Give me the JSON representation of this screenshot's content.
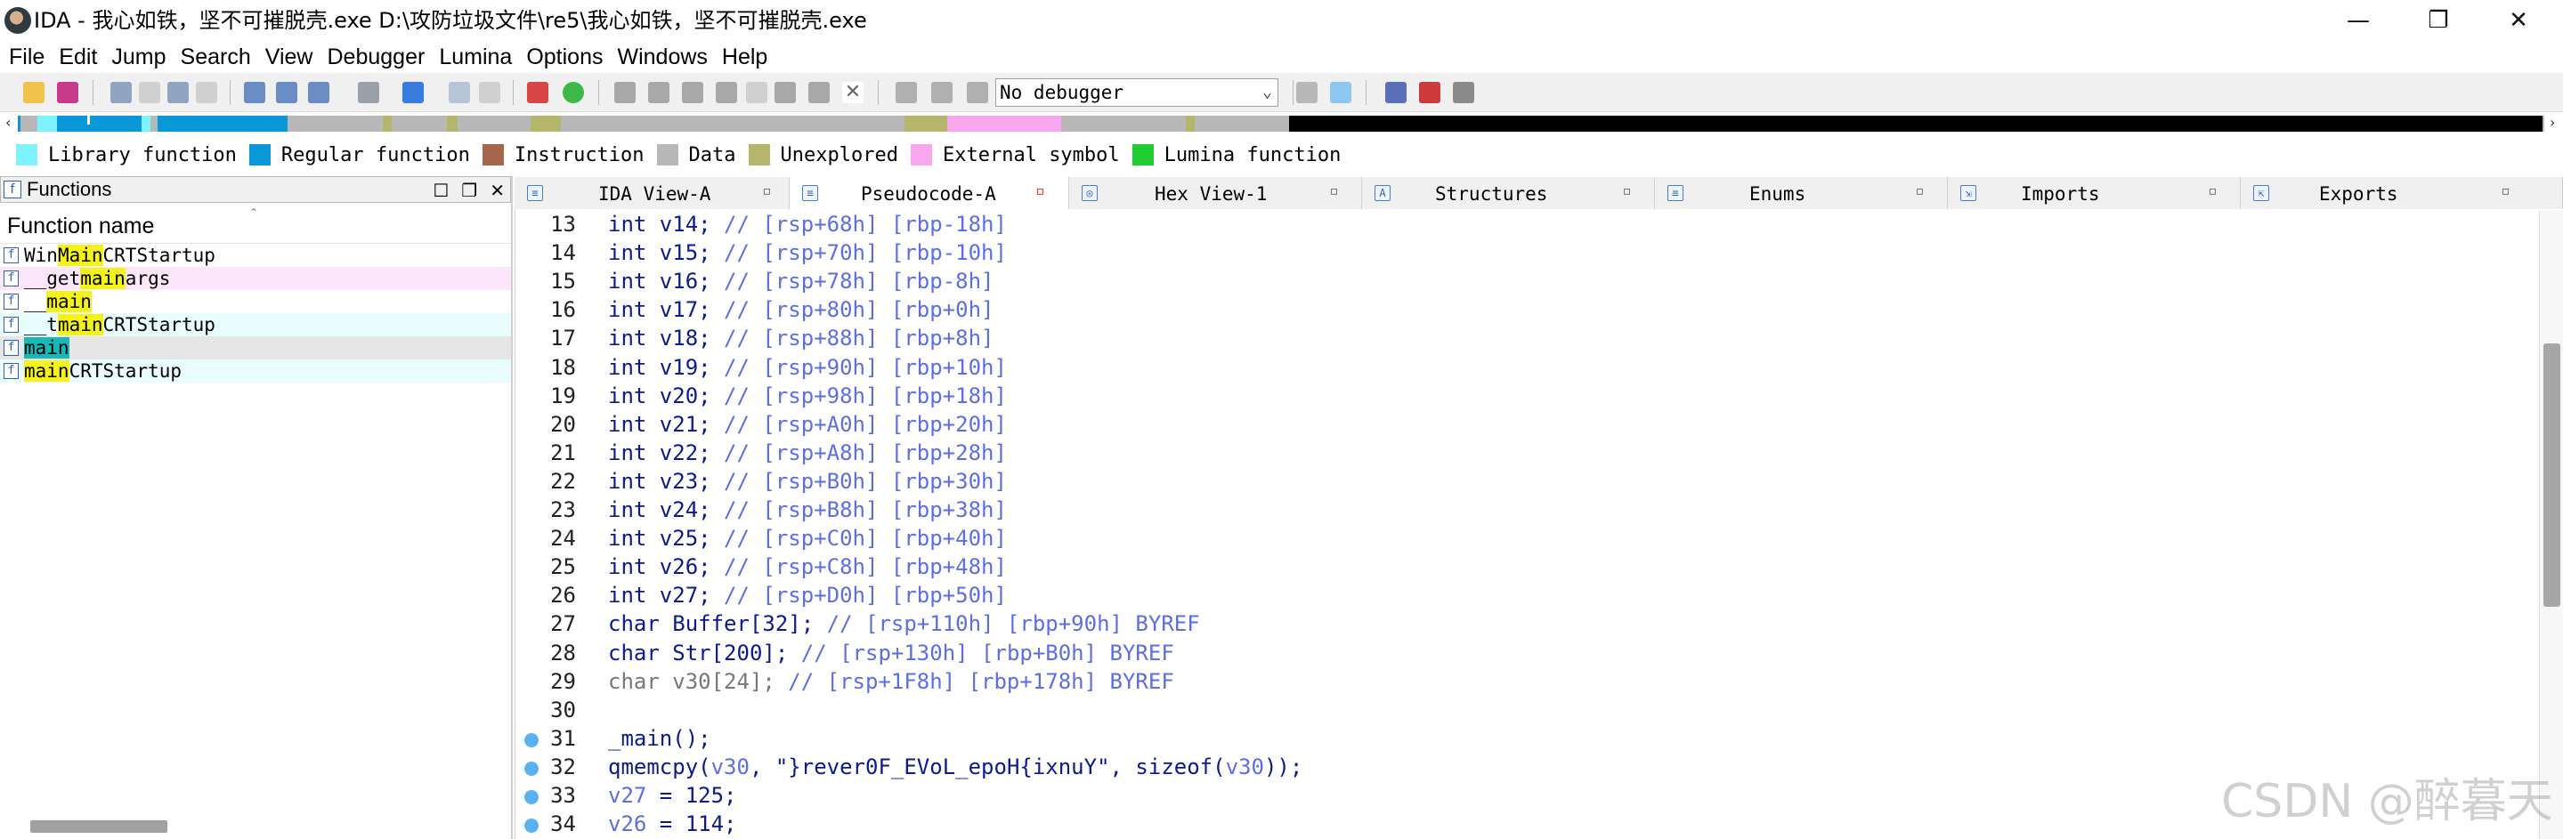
{
  "window": {
    "title": "IDA - 我心如铁，坚不可摧脱壳.exe D:\\攻防垃圾文件\\re5\\我心如铁，坚不可摧脱壳.exe",
    "controls": {
      "minimize": "—",
      "maximize": "❐",
      "close": "✕"
    }
  },
  "menu": [
    "File",
    "Edit",
    "Jump",
    "Search",
    "View",
    "Debugger",
    "Lumina",
    "Options",
    "Windows",
    "Help"
  ],
  "toolbar": {
    "debugger_select": "No debugger"
  },
  "nav_band_colors": {
    "library": "#7ef3ff",
    "regular": "#0a97d8",
    "data": "#b8b8b8",
    "unexplored": "#b5b56b",
    "external": "#f8a6ee",
    "black": "#000000"
  },
  "legend": [
    {
      "label": "Library function",
      "color": "#7ef3ff"
    },
    {
      "label": "Regular function",
      "color": "#0a97d8"
    },
    {
      "label": "Instruction",
      "color": "#a5674c"
    },
    {
      "label": "Data",
      "color": "#b8b8b8"
    },
    {
      "label": "Unexplored",
      "color": "#b5b56b"
    },
    {
      "label": "External symbol",
      "color": "#f8a6ee"
    },
    {
      "label": "Lumina function",
      "color": "#22cc33"
    }
  ],
  "functions_panel": {
    "title": "Functions",
    "column_header": "Function name",
    "rows": [
      {
        "pre": "Win",
        "match": "Main",
        "post": "CRTStartup",
        "bg": "#ffffff"
      },
      {
        "pre": "__get",
        "match": "main",
        "post": "args",
        "bg": "#fce6fb"
      },
      {
        "pre": "__",
        "match": "main",
        "post": "",
        "bg": "#ffffff"
      },
      {
        "pre": "__t",
        "match": "main",
        "post": "CRTStartup",
        "bg": "#e9fcfd"
      },
      {
        "pre": "",
        "match": "main",
        "post": "",
        "bg": "#e6e6e6",
        "selected": true
      },
      {
        "pre": "",
        "match": "main",
        "post": "CRTStartup",
        "bg": "#e9fcfd"
      }
    ]
  },
  "tabs": [
    {
      "label": "IDA View-A",
      "active": false
    },
    {
      "label": "Pseudocode-A",
      "active": true
    },
    {
      "label": "Hex View-1",
      "active": false
    },
    {
      "label": "Structures",
      "active": false
    },
    {
      "label": "Enums",
      "active": false
    },
    {
      "label": "Imports",
      "active": false
    },
    {
      "label": "Exports",
      "active": false
    }
  ],
  "code_lines": [
    {
      "n": "13",
      "bp": false,
      "parts": [
        [
          "int v14; ",
          "kw"
        ],
        [
          "// [rsp+68h] [rbp-18h]",
          "cm"
        ]
      ]
    },
    {
      "n": "14",
      "bp": false,
      "parts": [
        [
          "int v15; ",
          "kw"
        ],
        [
          "// [rsp+70h] [rbp-10h]",
          "cm"
        ]
      ]
    },
    {
      "n": "15",
      "bp": false,
      "parts": [
        [
          "int v16; ",
          "kw"
        ],
        [
          "// [rsp+78h] [rbp-8h]",
          "cm"
        ]
      ]
    },
    {
      "n": "16",
      "bp": false,
      "parts": [
        [
          "int v17; ",
          "kw"
        ],
        [
          "// [rsp+80h] [rbp+0h]",
          "cm"
        ]
      ]
    },
    {
      "n": "17",
      "bp": false,
      "parts": [
        [
          "int v18; ",
          "kw"
        ],
        [
          "// [rsp+88h] [rbp+8h]",
          "cm"
        ]
      ]
    },
    {
      "n": "18",
      "bp": false,
      "parts": [
        [
          "int v19; ",
          "kw"
        ],
        [
          "// [rsp+90h] [rbp+10h]",
          "cm"
        ]
      ]
    },
    {
      "n": "19",
      "bp": false,
      "parts": [
        [
          "int v20; ",
          "kw"
        ],
        [
          "// [rsp+98h] [rbp+18h]",
          "cm"
        ]
      ]
    },
    {
      "n": "20",
      "bp": false,
      "parts": [
        [
          "int v21; ",
          "kw"
        ],
        [
          "// [rsp+A0h] [rbp+20h]",
          "cm"
        ]
      ]
    },
    {
      "n": "21",
      "bp": false,
      "parts": [
        [
          "int v22; ",
          "kw"
        ],
        [
          "// [rsp+A8h] [rbp+28h]",
          "cm"
        ]
      ]
    },
    {
      "n": "22",
      "bp": false,
      "parts": [
        [
          "int v23; ",
          "kw"
        ],
        [
          "// [rsp+B0h] [rbp+30h]",
          "cm"
        ]
      ]
    },
    {
      "n": "23",
      "bp": false,
      "parts": [
        [
          "int v24; ",
          "kw"
        ],
        [
          "// [rsp+B8h] [rbp+38h]",
          "cm"
        ]
      ]
    },
    {
      "n": "24",
      "bp": false,
      "parts": [
        [
          "int v25; ",
          "kw"
        ],
        [
          "// [rsp+C0h] [rbp+40h]",
          "cm"
        ]
      ]
    },
    {
      "n": "25",
      "bp": false,
      "parts": [
        [
          "int v26; ",
          "kw"
        ],
        [
          "// [rsp+C8h] [rbp+48h]",
          "cm"
        ]
      ]
    },
    {
      "n": "26",
      "bp": false,
      "parts": [
        [
          "int v27; ",
          "kw"
        ],
        [
          "// [rsp+D0h] [rbp+50h]",
          "cm"
        ]
      ]
    },
    {
      "n": "27",
      "bp": false,
      "parts": [
        [
          "char Buffer[32]; ",
          "kw"
        ],
        [
          "// [rsp+110h] [rbp+90h] BYREF",
          "cm"
        ]
      ]
    },
    {
      "n": "28",
      "bp": false,
      "parts": [
        [
          "char Str[200]; ",
          "kw"
        ],
        [
          "// [rsp+130h] [rbp+B0h] BYREF",
          "cm"
        ]
      ]
    },
    {
      "n": "29",
      "bp": false,
      "parts": [
        [
          "char v30[24]; ",
          "gray"
        ],
        [
          "// [rsp+1F8h] [rbp+178h] BYREF",
          "cm"
        ]
      ]
    },
    {
      "n": "30",
      "bp": false,
      "parts": []
    },
    {
      "n": "31",
      "bp": true,
      "parts": [
        [
          "_main();",
          "kw"
        ]
      ]
    },
    {
      "n": "32",
      "bp": true,
      "parts": [
        [
          "qmemcpy(",
          "kw"
        ],
        [
          "v30",
          "var"
        ],
        [
          ", \"}rever0F_EVoL_epoH{ixnuY\", sizeof(",
          "kw"
        ],
        [
          "v30",
          "var"
        ],
        [
          "));",
          "kw"
        ]
      ]
    },
    {
      "n": "33",
      "bp": true,
      "parts": [
        [
          "v27",
          "var"
        ],
        [
          " = 125;",
          "kw"
        ]
      ]
    },
    {
      "n": "34",
      "bp": true,
      "parts": [
        [
          "v26",
          "var"
        ],
        [
          " = 114;",
          "kw"
        ]
      ]
    }
  ],
  "watermark": "CSDN @醉暮天"
}
